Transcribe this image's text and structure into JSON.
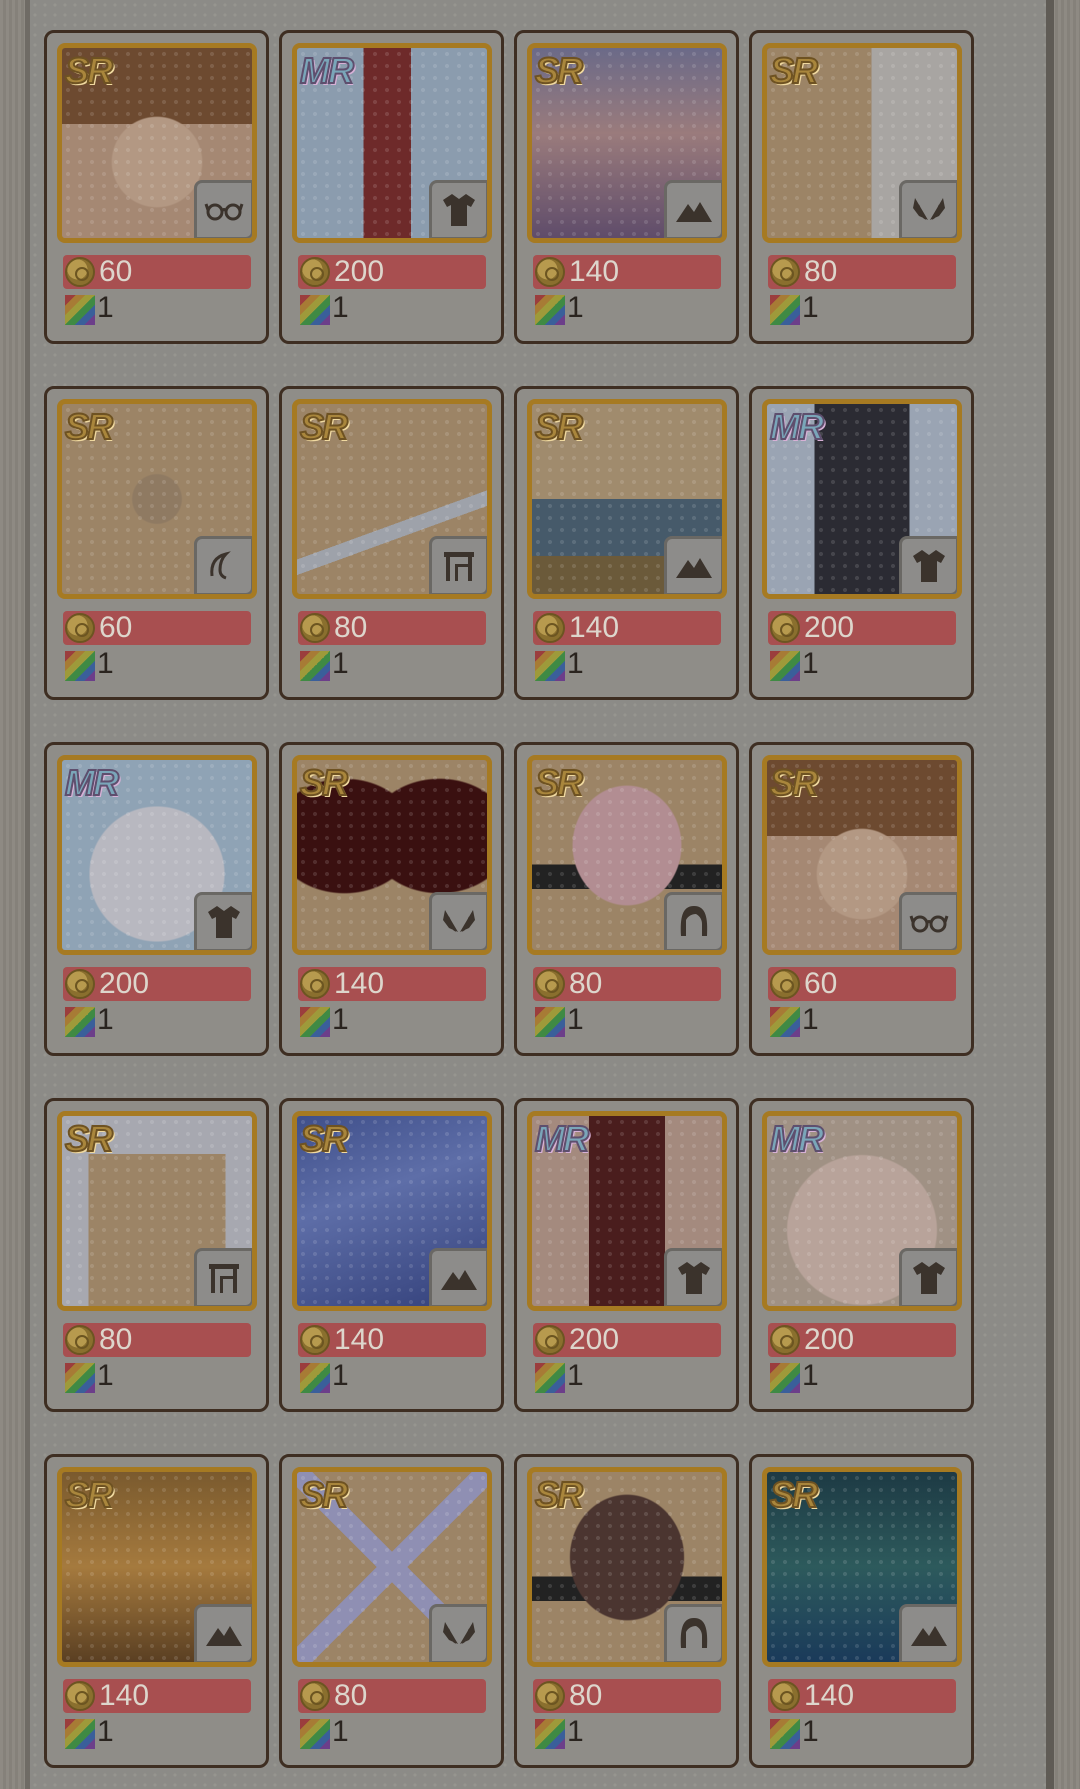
{
  "shop": {
    "items": [
      {
        "rarity": "SR",
        "type": "accessory-glasses",
        "price": "60",
        "qty": "1",
        "art": "face-brown"
      },
      {
        "rarity": "MR",
        "type": "dress",
        "price": "200",
        "qty": "1",
        "art": "kimono"
      },
      {
        "rarity": "SR",
        "type": "background",
        "price": "140",
        "qty": "1",
        "art": "sky-purple"
      },
      {
        "rarity": "SR",
        "type": "wings",
        "price": "80",
        "qty": "1",
        "art": "curtain"
      },
      {
        "rarity": "SR",
        "type": "hair-accessory",
        "price": "60",
        "qty": "1",
        "art": "ornament"
      },
      {
        "rarity": "SR",
        "type": "furniture",
        "price": "80",
        "qty": "1",
        "art": "feathers"
      },
      {
        "rarity": "SR",
        "type": "background",
        "price": "140",
        "qty": "1",
        "art": "plum-landscape"
      },
      {
        "rarity": "MR",
        "type": "dress",
        "price": "200",
        "qty": "1",
        "art": "dark-outfit"
      },
      {
        "rarity": "MR",
        "type": "dress",
        "price": "200",
        "qty": "1",
        "art": "white-dress"
      },
      {
        "rarity": "SR",
        "type": "wings",
        "price": "140",
        "qty": "1",
        "art": "red-wings"
      },
      {
        "rarity": "SR",
        "type": "hair",
        "price": "80",
        "qty": "1",
        "art": "pink-hair"
      },
      {
        "rarity": "SR",
        "type": "accessory-glasses",
        "price": "60",
        "qty": "1",
        "art": "face-brown"
      },
      {
        "rarity": "SR",
        "type": "furniture",
        "price": "80",
        "qty": "1",
        "art": "arch"
      },
      {
        "rarity": "SR",
        "type": "background",
        "price": "140",
        "qty": "1",
        "art": "blue-sky"
      },
      {
        "rarity": "MR",
        "type": "dress",
        "price": "200",
        "qty": "1",
        "art": "red-outfit"
      },
      {
        "rarity": "MR",
        "type": "dress",
        "price": "200",
        "qty": "1",
        "art": "floral-dress"
      },
      {
        "rarity": "SR",
        "type": "background",
        "price": "140",
        "qty": "1",
        "art": "golden-garden"
      },
      {
        "rarity": "SR",
        "type": "wings",
        "price": "80",
        "qty": "1",
        "art": "fairy-wings"
      },
      {
        "rarity": "SR",
        "type": "hair",
        "price": "80",
        "qty": "1",
        "art": "brown-curls"
      },
      {
        "rarity": "SR",
        "type": "background",
        "price": "140",
        "qty": "1",
        "art": "night-forest"
      }
    ]
  },
  "icons": {
    "currency": "gold-coin-icon",
    "material": "rainbow-gem-icon"
  },
  "colors": {
    "price_bar": "#a84f50",
    "card_border": "#3e2e22",
    "thumb_border": "#a67a22"
  }
}
